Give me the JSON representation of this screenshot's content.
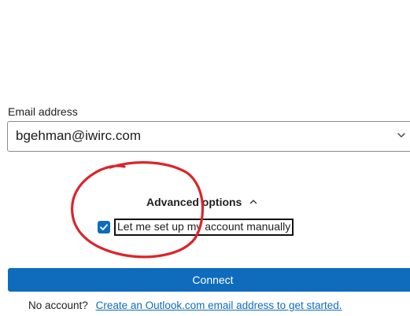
{
  "form": {
    "email_label": "Email address",
    "email_value": "bgehman@iwirc.com",
    "advanced_label": "Advanced options",
    "manual_checkbox_label": "Let me set up my account manually",
    "manual_checked": true,
    "connect_label": "Connect"
  },
  "footer": {
    "prompt": "No account?",
    "link_text": "Create an Outlook.com email address to get started."
  },
  "colors": {
    "accent": "#0f6cbd",
    "annotation": "#d9262c"
  },
  "icons": {
    "dropdown": "chevron-down-icon",
    "advanced_toggle": "chevron-up-icon",
    "checkbox": "check-icon"
  }
}
